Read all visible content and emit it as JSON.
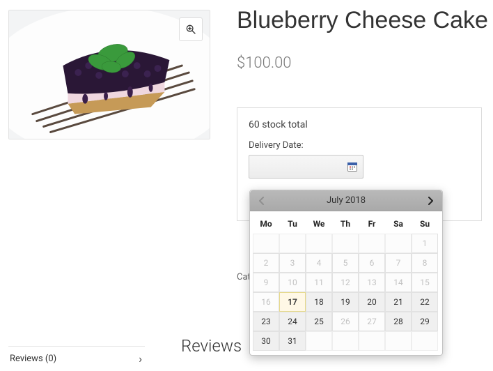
{
  "product": {
    "title": "Blueberry Cheese Cake",
    "price": "$100.00",
    "stock_text": "60 stock total",
    "delivery_label": "Delivery Date:",
    "category_fragment": "Cat"
  },
  "calendar": {
    "title": "July 2018",
    "daynames": [
      "Mo",
      "Tu",
      "We",
      "Th",
      "Fr",
      "Sa",
      "Su"
    ],
    "weeks": [
      [
        {
          "n": "",
          "s": "blank"
        },
        {
          "n": "",
          "s": "blank"
        },
        {
          "n": "",
          "s": "blank"
        },
        {
          "n": "",
          "s": "blank"
        },
        {
          "n": "",
          "s": "blank"
        },
        {
          "n": "",
          "s": "blank"
        },
        {
          "n": "1",
          "s": "dis"
        }
      ],
      [
        {
          "n": "2",
          "s": "dis"
        },
        {
          "n": "3",
          "s": "dis"
        },
        {
          "n": "4",
          "s": "dis"
        },
        {
          "n": "5",
          "s": "dis"
        },
        {
          "n": "6",
          "s": "dis"
        },
        {
          "n": "7",
          "s": "dis"
        },
        {
          "n": "8",
          "s": "dis"
        }
      ],
      [
        {
          "n": "9",
          "s": "dis"
        },
        {
          "n": "10",
          "s": "dis"
        },
        {
          "n": "11",
          "s": "dis"
        },
        {
          "n": "12",
          "s": "dis"
        },
        {
          "n": "13",
          "s": "dis"
        },
        {
          "n": "14",
          "s": "dis"
        },
        {
          "n": "15",
          "s": "dis"
        }
      ],
      [
        {
          "n": "16",
          "s": "dis"
        },
        {
          "n": "17",
          "s": "today"
        },
        {
          "n": "18",
          "s": "en"
        },
        {
          "n": "19",
          "s": "en"
        },
        {
          "n": "20",
          "s": "en"
        },
        {
          "n": "21",
          "s": "en"
        },
        {
          "n": "22",
          "s": "en"
        }
      ],
      [
        {
          "n": "23",
          "s": "en"
        },
        {
          "n": "24",
          "s": "en"
        },
        {
          "n": "25",
          "s": "en"
        },
        {
          "n": "26",
          "s": "dis"
        },
        {
          "n": "27",
          "s": "dis"
        },
        {
          "n": "28",
          "s": "en"
        },
        {
          "n": "29",
          "s": "en"
        }
      ],
      [
        {
          "n": "30",
          "s": "en"
        },
        {
          "n": "31",
          "s": "en"
        },
        {
          "n": "",
          "s": "blank"
        },
        {
          "n": "",
          "s": "blank"
        },
        {
          "n": "",
          "s": "blank"
        },
        {
          "n": "",
          "s": "blank"
        },
        {
          "n": "",
          "s": "blank"
        }
      ]
    ]
  },
  "reviews": {
    "heading": "Reviews",
    "tab_label": "Reviews (0)"
  }
}
